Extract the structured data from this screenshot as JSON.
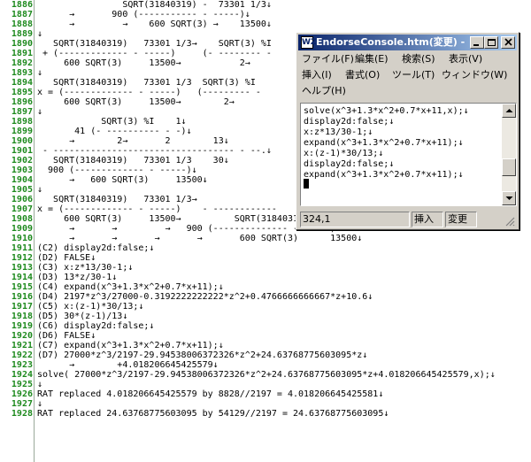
{
  "editor": {
    "line_numbers": [
      "1886",
      "1887",
      "1888",
      "1889",
      "1890",
      "1891",
      "1892",
      "1893",
      "1894",
      "1895",
      "1896",
      "1897",
      "1898",
      "1899",
      "1900",
      "1901",
      "1902",
      "1903",
      "1904",
      "1905",
      "1906",
      "1907",
      "1908",
      "1909",
      "1910",
      "1911",
      "1912",
      "1913",
      "1914",
      "1915",
      "1916",
      "1917",
      "1918",
      "1919",
      "1920",
      "1921",
      "1922",
      "1923",
      "1924",
      "1925",
      "1926",
      "1927",
      "1928"
    ],
    "lines": [
      "                SQRT(31840319) -  73301 1/3↓",
      "      →       900 (----------- - -----)↓",
      "      →         →    600 SQRT(3) →    13500↓",
      "↓",
      "   SQRT(31840319)   73301 1/3→    SQRT(3) %I",
      " + (------------- - -----)     (- -------- - ",
      "     600 SQRT(3)     13500→           2→",
      "↓",
      "   SQRT(31840319)   73301 1/3  SQRT(3) %I",
      "x = (------------- - -----)   (--------- - ",
      "     600 SQRT(3)     13500→        2→",
      "↓",
      "            SQRT(3) %I    1↓",
      "       41 (- ---------- - -)↓",
      "      →        2→       2        13↓",
      " - ---------------------------------- - --.↓",
      "   SQRT(31840319)   73301 1/3    30↓",
      "  900 (------------- - -----)↓",
      "      →   600 SQRT(3)     13500↓",
      "↓",
      "   SQRT(31840319)   73301 1/3→",
      "x = (------------- - -----)    - ------------",
      "     600 SQRT(3)     13500→          SQRT(31840319)    73301 1/3    30↓",
      "      →       →         →   900 (-------------- - -----)↓",
      "      →       →       →       →       600 SQRT(3)      13500↓",
      "(C2) display2d:false;↓",
      "(D2) FALSE↓",
      "(C3) x:z*13/30-1;↓",
      "(D3) 13*z/30-1↓",
      "(C4) expand(x^3+1.3*x^2+0.7*x+11);↓",
      "(D4) 2197*z^3/27000-0.3192222222222*z^2+0.4766666666667*z+10.6↓",
      "(C5) x:(z-1)*30/13;↓",
      "(D5) 30*(z-1)/13↓",
      "(C6) display2d:false;↓",
      "(D6) FALSE↓",
      "(C7) expand(x^3+1.3*x^2+0.7*x+11);↓",
      "(D7) 27000*z^3/2197-29.94538006372326*z^2+24.63768775603095*z↓",
      "      →        +4.018206645425579↓",
      "solve( 27000*z^3/2197-29.94538006372326*z^2+24.63768775603095*z+4.018206645425579,x);↓",
      "↓",
      "RAT replaced 4.018206645425579 by 8828//2197 = 4.018206645425581↓",
      "↓",
      "RAT replaced 24.63768775603095 by 54129//2197 = 24.63768775603095↓"
    ]
  },
  "window": {
    "app_icon": "WZ",
    "title": "EndorseConsole.htm(変更) - WZ H...",
    "menu": {
      "file": "ファイル(F)",
      "edit": "編集(E)",
      "search": "検索(S)",
      "view": "表示(V)",
      "insert": "挿入(I)",
      "format": "書式(O)",
      "tools": "ツール(T)",
      "window": "ウィンドウ(W)",
      "help": "ヘルプ(H)"
    },
    "lines": [
      "solve(x^3+1.3*x^2+0.7*x+11,x);↓",
      "display2d:false;↓",
      "x:z*13/30-1;↓",
      "expand(x^3+1.3*x^2+0.7*x+11);↓",
      "x:(z-1)*30/13;↓",
      "display2d:false;↓",
      "expand(x^3+1.3*x^2+0.7*x+11);↓",
      "↓"
    ],
    "status": {
      "position": "324,1",
      "insert_mode": "挿入",
      "modified": "変更"
    }
  }
}
